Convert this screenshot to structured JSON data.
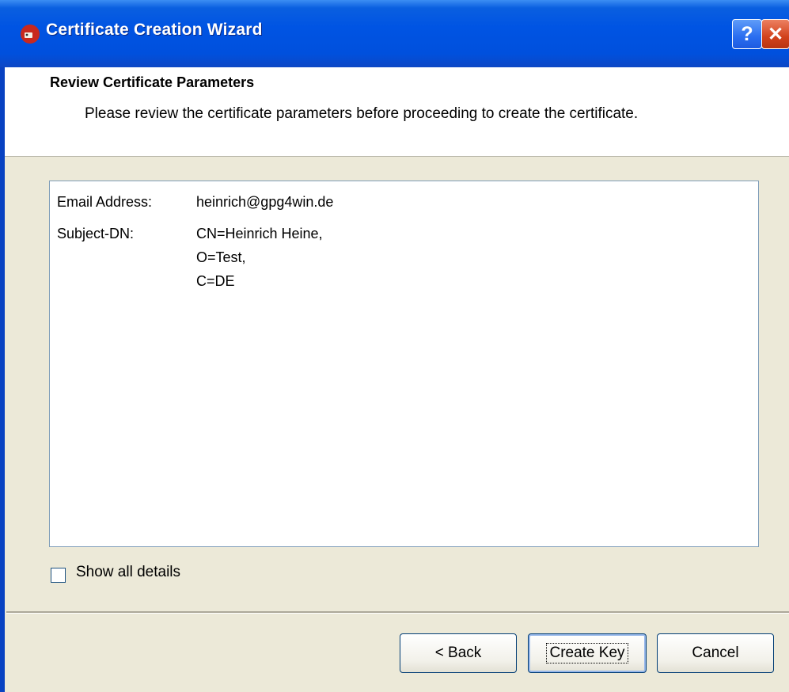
{
  "window": {
    "title": "Certificate Creation Wizard",
    "help_label": "?",
    "close_label": "✕"
  },
  "header": {
    "title": "Review Certificate Parameters",
    "description": "Please review the certificate parameters before proceeding to create the certificate."
  },
  "review": {
    "email_label": "Email Address:",
    "email_value": "heinrich@gpg4win.de",
    "subject_label": "Subject-DN:",
    "subject_lines": [
      "CN=Heinrich Heine,",
      "O=Test,",
      "C=DE"
    ]
  },
  "options": {
    "show_all_details_label": "Show all details",
    "show_all_details_checked": false
  },
  "buttons": {
    "back": "< Back",
    "create_key": "Create Key",
    "cancel": "Cancel"
  },
  "icons": {
    "app": "wizard-app-icon",
    "help": "help-icon",
    "close": "close-icon"
  },
  "colors": {
    "titlebar": "#0054e3",
    "dialog_bg": "#ece9d8",
    "close_button": "#d2421c"
  }
}
